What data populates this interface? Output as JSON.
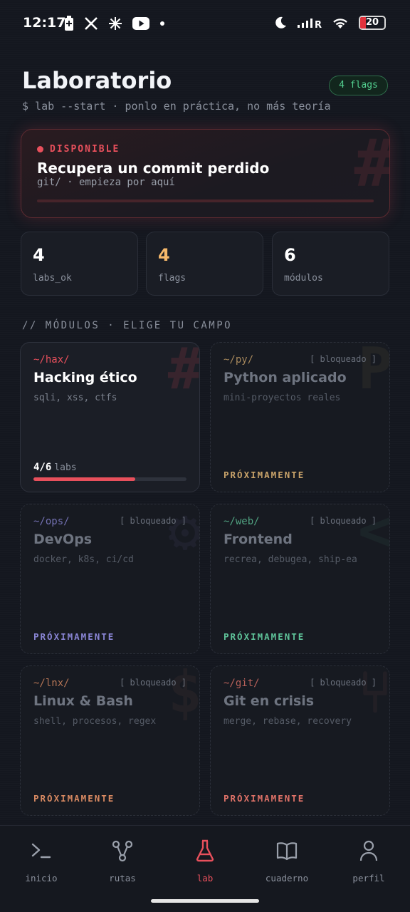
{
  "status_bar": {
    "time": "12:17",
    "battery": "20"
  },
  "header": {
    "title": "Laboratorio",
    "subtitle": "$ lab --start · ponlo en práctica, no más teoría",
    "flags_badge": "4 flags"
  },
  "hero": {
    "status": "DISPONIBLE",
    "title": "Recupera un commit perdido",
    "subtitle": "git/ · empieza por aquí",
    "accent": "#e8505c"
  },
  "stats": [
    {
      "value": "4",
      "label": "labs_ok",
      "color": "#ffffff"
    },
    {
      "value": "4",
      "label": "flags",
      "color": "#f5b86a"
    },
    {
      "value": "6",
      "label": "módulos",
      "color": "#ffffff"
    }
  ],
  "section_label": "// MÓDULOS · ELIGE TU CAMPO",
  "modules": [
    {
      "path": "~/hax/",
      "title": "Hacking ético",
      "tags": "sqli, xss, ctfs",
      "status": "active",
      "progress_text": "4/6",
      "progress_unit": "labs",
      "progress_fraction": 0.667,
      "accent": "#e8505c"
    },
    {
      "path": "~/py/",
      "lock": "[ bloqueado ]",
      "title": "Python aplicado",
      "tags": "mini-proyectos reales",
      "soon": "PRÓXIMAMENTE",
      "accent": "#c9a36a"
    },
    {
      "path": "~/ops/",
      "lock": "[ bloqueado ]",
      "title": "DevOps",
      "tags": "docker, k8s, ci/cd",
      "soon": "PRÓXIMAMENTE",
      "accent": "#8a86d6"
    },
    {
      "path": "~/web/",
      "lock": "[ bloqueado ]",
      "title": "Frontend",
      "tags": "recrea, debugea, ship-ea",
      "soon": "PRÓXIMAMENTE",
      "accent": "#5fc49a"
    },
    {
      "path": "~/lnx/",
      "lock": "[ bloqueado ]",
      "title": "Linux & Bash",
      "tags": "shell, procesos, regex",
      "soon": "PRÓXIMAMENTE",
      "accent": "#d98a62"
    },
    {
      "path": "~/git/",
      "lock": "[ bloqueado ]",
      "title": "Git en crisis",
      "tags": "merge, rebase, recovery",
      "soon": "PRÓXIMAMENTE",
      "accent": "#e07268"
    }
  ],
  "nav": [
    {
      "label": "inicio",
      "icon": "terminal-icon"
    },
    {
      "label": "rutas",
      "icon": "routes-icon"
    },
    {
      "label": "lab",
      "icon": "flask-icon",
      "active": true
    },
    {
      "label": "cuaderno",
      "icon": "book-icon"
    },
    {
      "label": "perfil",
      "icon": "user-icon"
    }
  ]
}
